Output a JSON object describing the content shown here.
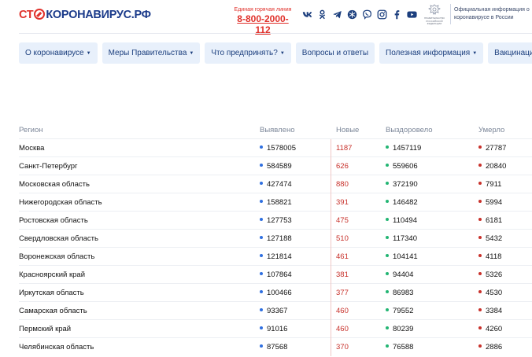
{
  "header": {
    "logo": {
      "part1": "СТ",
      "part2": "П",
      "part3": "КОРОНАВИРУС.РФ"
    },
    "hotline_label": "Единая горячая линия",
    "hotline_number": "8-800-2000-112",
    "socials": [
      "vk-icon",
      "odnoklassniki-icon",
      "telegram-icon",
      "snowflake-icon",
      "viber-icon",
      "instagram-icon",
      "facebook-icon",
      "youtube-icon"
    ],
    "gov_emblem_text": "ПРАВИТЕЛЬСТВО РОССИЙСКОЙ ФЕДЕРАЦИИ",
    "gov_info": "Официальная информация о коронавирусе в России"
  },
  "nav": [
    {
      "label": "О коронавирусе",
      "dropdown": true
    },
    {
      "label": "Меры Правительства",
      "dropdown": true
    },
    {
      "label": "Что предпринять?",
      "dropdown": true
    },
    {
      "label": "Вопросы и ответы",
      "dropdown": false
    },
    {
      "label": "Полезная информация",
      "dropdown": true
    },
    {
      "label": "Вакцинация",
      "dropdown": true
    }
  ],
  "table": {
    "headers": {
      "region": "Регион",
      "found": "Выявлено",
      "new": "Новые",
      "recovered": "Выздоровело",
      "died": "Умерло"
    },
    "rows": [
      {
        "region": "Москва",
        "found": "1578005",
        "new": "1187",
        "recovered": "1457119",
        "died": "27787"
      },
      {
        "region": "Санкт-Петербург",
        "found": "584589",
        "new": "626",
        "recovered": "559606",
        "died": "20840"
      },
      {
        "region": "Московская область",
        "found": "427474",
        "new": "880",
        "recovered": "372190",
        "died": "7911"
      },
      {
        "region": "Нижегородская область",
        "found": "158821",
        "new": "391",
        "recovered": "146482",
        "died": "5994"
      },
      {
        "region": "Ростовская область",
        "found": "127753",
        "new": "475",
        "recovered": "110494",
        "died": "6181"
      },
      {
        "region": "Свердловская область",
        "found": "127188",
        "new": "510",
        "recovered": "117340",
        "died": "5432"
      },
      {
        "region": "Воронежская область",
        "found": "121814",
        "new": "461",
        "recovered": "104141",
        "died": "4118"
      },
      {
        "region": "Красноярский край",
        "found": "107864",
        "new": "381",
        "recovered": "94404",
        "died": "5326"
      },
      {
        "region": "Иркутская область",
        "found": "100466",
        "new": "377",
        "recovered": "86983",
        "died": "4530"
      },
      {
        "region": "Самарская область",
        "found": "93367",
        "new": "460",
        "recovered": "79552",
        "died": "3384"
      },
      {
        "region": "Пермский край",
        "found": "91016",
        "new": "460",
        "recovered": "80239",
        "died": "4260"
      },
      {
        "region": "Челябинская область",
        "found": "87568",
        "new": "370",
        "recovered": "76588",
        "died": "2886"
      }
    ]
  },
  "colors": {
    "brand_blue": "#1a3a8a",
    "brand_red": "#e0312b",
    "nav_bg": "#e8f0fb",
    "dot_found": "#2f6fe0",
    "dot_recovered": "#22b573",
    "dot_died": "#c8312b"
  }
}
